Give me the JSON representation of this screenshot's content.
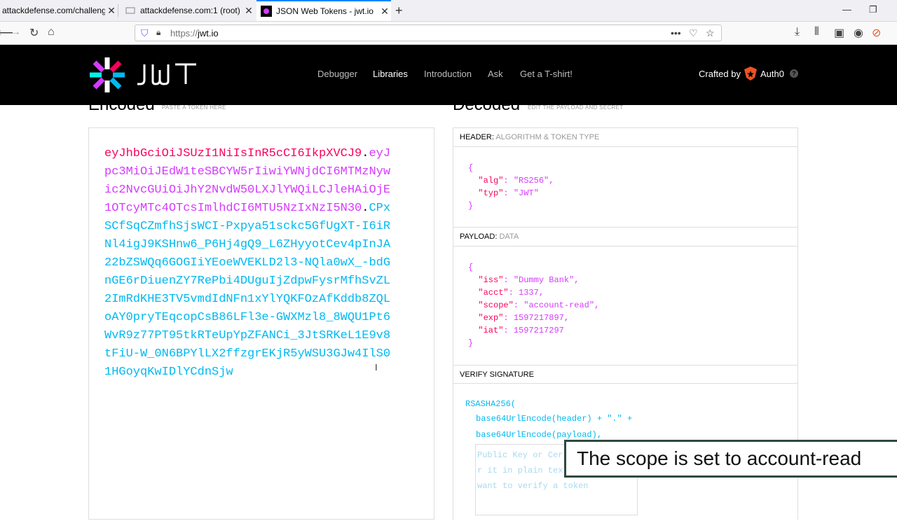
{
  "browser": {
    "tabs": [
      {
        "title": "attackdefense.com/challengedet"
      },
      {
        "title": "attackdefense.com:1 (root)"
      },
      {
        "title": "JSON Web Tokens - jwt.io"
      }
    ],
    "url_prefix": "https://",
    "url_host": "jwt.io",
    "icons": [
      "back-arrow-icon",
      "forward-arrow-icon",
      "reload-icon",
      "home-icon",
      "shield-icon",
      "lock-icon",
      "more-icon",
      "pocket-icon",
      "star-icon",
      "download-icon",
      "library-icon",
      "sidebar-icon",
      "account-icon",
      "extension-icon",
      "new-tab-icon",
      "minimize-icon",
      "restore-icon"
    ]
  },
  "site": {
    "wordmark": "JWT",
    "nav": [
      "Debugger",
      "Libraries",
      "Introduction",
      "Ask",
      "Get a T-shirt!"
    ],
    "crafted_by": "Crafted by",
    "auth0": "Auth0"
  },
  "encoded": {
    "heading": "Encoded",
    "sub": "PASTE A TOKEN HERE",
    "header_part": "eyJhbGciOiJSUzI1NiIsInR5cCI6IkpXVCJ9",
    "payload_part": "eyJpc3MiOiJEdW1teSBCYW5rIiwiYWNjdCI6MTMzNywic2NvcGUiOiJhY2NvdW50LXJlYWQiLCJleHAiOjE1OTcyMTc4OTcsImlhdCI6MTU5NzIxNzI5N30",
    "signature_part": "CPxSCfSqCZmfhSjsWCI-Pxpya51sckc5GfUgXT-I6iRNl4igJ9KSHnw6_P6Hj4gQ9_L6ZHyyotCev4pInJA22bZSWQq6GOGIiYEoeWVEKLD2l3-NQla0wX_-bdGnGE6rDiuenZY7RePbi4DUguIjZdpwFysrMfhSvZL2ImRdKHE3TV5vmdIdNFn1xYlYQKFOzAfKddb8ZQLoAY0pryTEqcopCsB86LFl3e-GWXMzl8_8WQU1Pt6WvR9z77PT95tkRTeUpYpZFANCi_3JtSRKeL1E9v8tFiU-W_0N6BPYlLX2ffzgrEKjR5yWSU3GJw4IlS01HGoyqKwIDlYCdnSjw",
    "dot": "."
  },
  "decoded": {
    "heading": "Decoded",
    "sub": "EDIT THE PAYLOAD AND SECRET",
    "header_title": "HEADER:",
    "header_sub": "ALGORITHM & TOKEN TYPE",
    "header_json": {
      "alg": "\"RS256\"",
      "typ": "\"JWT\""
    },
    "payload_title": "PAYLOAD:",
    "payload_sub": "DATA",
    "payload_json": {
      "iss": "\"Dummy Bank\"",
      "acct": "1337",
      "scope": "\"account-read\"",
      "exp": "1597217897",
      "iat": "1597217297"
    },
    "verify_title": "VERIFY SIGNATURE",
    "sig_line1": "RSASHA256(",
    "sig_line2": "base64UrlEncode(header) + \".\" +",
    "sig_line3": "base64UrlEncode(payload),",
    "key_placeholder": "Public Key or Cer\nr it in plain tex\nwant to verify a token"
  },
  "caption": "The scope is set to account-read"
}
